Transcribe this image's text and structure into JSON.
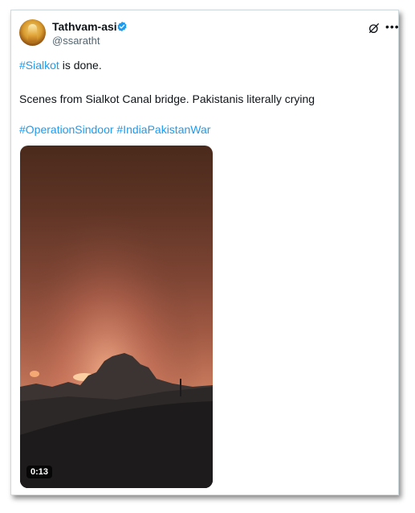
{
  "author": {
    "display_name": "Tathvam-asi",
    "handle": "@ssaratht",
    "verified": true,
    "verified_color": "#1d9bf0"
  },
  "header_icons": [
    "grok-icon",
    "more-options-icon"
  ],
  "tweet": {
    "hashtag_sialkot": "#Sialkot",
    "line1_rest": " is done.",
    "line2": "Scenes from Sialkot Canal bridge. Pakistanis literally crying",
    "hashtag_operation": "#OperationSindoor",
    "hashtag_war": "#IndiaPakistanWar"
  },
  "media": {
    "type": "video",
    "duration": "0:13"
  },
  "colors": {
    "text": "#0f1419",
    "secondary_text": "#536471",
    "link": "#1d9bf0",
    "border": "#cfd9de"
  }
}
